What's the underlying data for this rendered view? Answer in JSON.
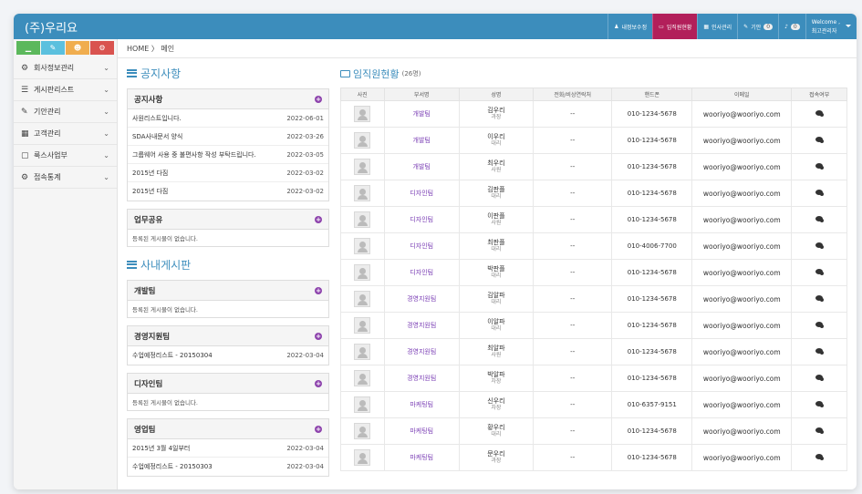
{
  "app": {
    "title": "(주)우리요"
  },
  "topnav": [
    {
      "icon": "user-icon",
      "label": "내정보수정",
      "badge": null,
      "active": false
    },
    {
      "icon": "folder-icon",
      "label": "임직원현황",
      "badge": null,
      "active": true
    },
    {
      "icon": "calendar-icon",
      "label": "인사관리",
      "badge": null,
      "active": false
    },
    {
      "icon": "edit-icon",
      "label": "기안",
      "badge": "0",
      "active": false
    },
    {
      "icon": "bell-icon",
      "label": "",
      "badge": "0",
      "active": false
    }
  ],
  "user": {
    "welcome": "Welcome ,",
    "name": "최고관리자"
  },
  "sidebar": {
    "buttons": [
      {
        "icon": "chart-icon",
        "color": "#5cb85c"
      },
      {
        "icon": "pencil-icon",
        "color": "#5bc0de"
      },
      {
        "icon": "users-icon",
        "color": "#f0ad4e"
      },
      {
        "icon": "cogs-icon",
        "color": "#d9534f"
      }
    ],
    "items": [
      {
        "icon": "dashboard-icon",
        "glyph": "⚙",
        "label": "회사정보관리"
      },
      {
        "icon": "list-icon",
        "glyph": "☰",
        "label": "게시판리스트"
      },
      {
        "icon": "edit-icon",
        "glyph": "✎",
        "label": "기안관리"
      },
      {
        "icon": "table-icon",
        "glyph": "▦",
        "label": "고객관리"
      },
      {
        "icon": "file-icon",
        "glyph": "▢",
        "label": "룩스사업부"
      },
      {
        "icon": "cogs-icon",
        "glyph": "⚙",
        "label": "접속통계"
      }
    ]
  },
  "breadcrumb": {
    "home": "HOME",
    "sep": "〉",
    "current": "메인"
  },
  "notice": {
    "title": "공지사항",
    "panels": [
      {
        "name": "공지사항",
        "rows": [
          {
            "title": "사원리스트입니다.",
            "date": "2022-06-01"
          },
          {
            "title": "SDA사내문서 양식",
            "date": "2022-03-26"
          },
          {
            "title": "그룹웨어 사용 중 불편사항 작성 부탁드립니다.",
            "date": "2022-03-05"
          },
          {
            "title": "2015년 다짐",
            "date": "2022-03-02"
          },
          {
            "title": "2015년 다짐",
            "date": "2022-03-02"
          }
        ],
        "empty": null
      },
      {
        "name": "업무공유",
        "rows": [],
        "empty": "등록된 게시물이 없습니다."
      }
    ]
  },
  "board": {
    "title": "사내게시판",
    "panels": [
      {
        "name": "개발팀",
        "rows": [],
        "empty": "등록된 게시물이 없습니다."
      },
      {
        "name": "경영지원팀",
        "rows": [
          {
            "title": "수업예정리스트 - 20150304",
            "date": "2022-03-04"
          }
        ],
        "empty": null
      },
      {
        "name": "디자인팀",
        "rows": [],
        "empty": "등록된 게시물이 없습니다."
      },
      {
        "name": "영업팀",
        "rows": [
          {
            "title": "2015년 3월 4일부터",
            "date": "2022-03-04"
          },
          {
            "title": "수업예정리스트 - 20150303",
            "date": "2022-03-04"
          }
        ],
        "empty": null
      }
    ]
  },
  "employees": {
    "title": "임직원현황",
    "count": "(26명)",
    "columns": [
      "사진",
      "부서명",
      "성명",
      "전화/비상연락처",
      "핸드폰",
      "이메일",
      "접속여부"
    ],
    "rows": [
      {
        "dept": "개발팀",
        "name": "김우리",
        "rank": "과장",
        "phone": "--",
        "mobile": "010-1234-5678",
        "email": "wooriyo@wooriyo.com"
      },
      {
        "dept": "개발팀",
        "name": "이우리",
        "rank": "대리",
        "phone": "--",
        "mobile": "010-1234-5678",
        "email": "wooriyo@wooriyo.com"
      },
      {
        "dept": "개발팀",
        "name": "최우리",
        "rank": "사원",
        "phone": "--",
        "mobile": "010-1234-5678",
        "email": "wooriyo@wooriyo.com"
      },
      {
        "dept": "디자인팀",
        "name": "김판플",
        "rank": "대리",
        "phone": "--",
        "mobile": "010-1234-5678",
        "email": "wooriyo@wooriyo.com"
      },
      {
        "dept": "디자인팀",
        "name": "이판플",
        "rank": "사원",
        "phone": "--",
        "mobile": "010-1234-5678",
        "email": "wooriyo@wooriyo.com"
      },
      {
        "dept": "디자인팀",
        "name": "최판플",
        "rank": "대리",
        "phone": "--",
        "mobile": "010-4006-7700",
        "email": "wooriyo@wooriyo.com"
      },
      {
        "dept": "디자인팀",
        "name": "박판플",
        "rank": "대리",
        "phone": "--",
        "mobile": "010-1234-5678",
        "email": "wooriyo@wooriyo.com"
      },
      {
        "dept": "경영지원팀",
        "name": "김알파",
        "rank": "대리",
        "phone": "--",
        "mobile": "010-1234-5678",
        "email": "wooriyo@wooriyo.com"
      },
      {
        "dept": "경영지원팀",
        "name": "이알파",
        "rank": "대리",
        "phone": "--",
        "mobile": "010-1234-5678",
        "email": "wooriyo@wooriyo.com"
      },
      {
        "dept": "경영지원팀",
        "name": "최알파",
        "rank": "사원",
        "phone": "--",
        "mobile": "010-1234-5678",
        "email": "wooriyo@wooriyo.com"
      },
      {
        "dept": "경영지원팀",
        "name": "박알파",
        "rank": "차장",
        "phone": "--",
        "mobile": "010-1234-5678",
        "email": "wooriyo@wooriyo.com"
      },
      {
        "dept": "마케팅팀",
        "name": "신우리",
        "rank": "차장",
        "phone": "--",
        "mobile": "010-6357-9151",
        "email": "wooriyo@wooriyo.com"
      },
      {
        "dept": "마케팅팀",
        "name": "황우리",
        "rank": "대리",
        "phone": "--",
        "mobile": "010-1234-5678",
        "email": "wooriyo@wooriyo.com"
      },
      {
        "dept": "마케팅팀",
        "name": "문우리",
        "rank": "과장",
        "phone": "--",
        "mobile": "010-1234-5678",
        "email": "wooriyo@wooriyo.com"
      }
    ]
  }
}
